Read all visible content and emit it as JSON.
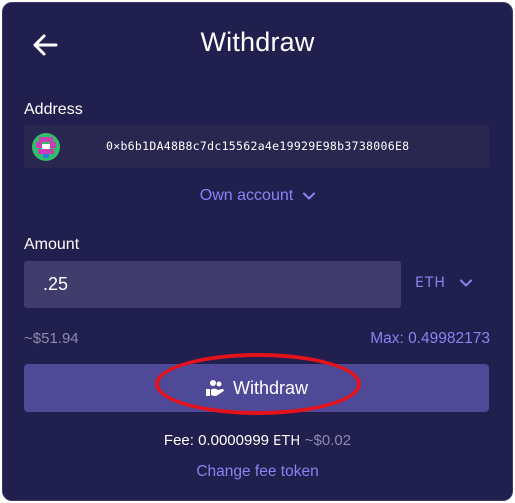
{
  "header": {
    "title": "Withdraw",
    "back_icon": "arrow-left-icon"
  },
  "address": {
    "label": "Address",
    "value": "0×b6b1DA48B8c7dc15562a4e19929E98b3738006E8",
    "avatar_icon": "identicon-avatar",
    "own_account_label": "Own account",
    "chevron_icon": "chevron-down-icon"
  },
  "amount": {
    "label": "Amount",
    "value": ".25",
    "token": "ETH",
    "usd_value": "~$51.94",
    "max_label": "Max: 0.49982173"
  },
  "action": {
    "withdraw_label": "Withdraw",
    "icon": "hand-coins-icon"
  },
  "fee": {
    "prefix": "Fee:",
    "amount": "0.0000999",
    "token": "ETH",
    "usd": "~$0.02",
    "change_label": "Change fee token"
  },
  "colors": {
    "background": "#211f4e",
    "field": "#29274f",
    "input": "#403c6c",
    "accent": "#8c82f2",
    "button": "#4f4a97",
    "annotation": "#e3121b"
  }
}
